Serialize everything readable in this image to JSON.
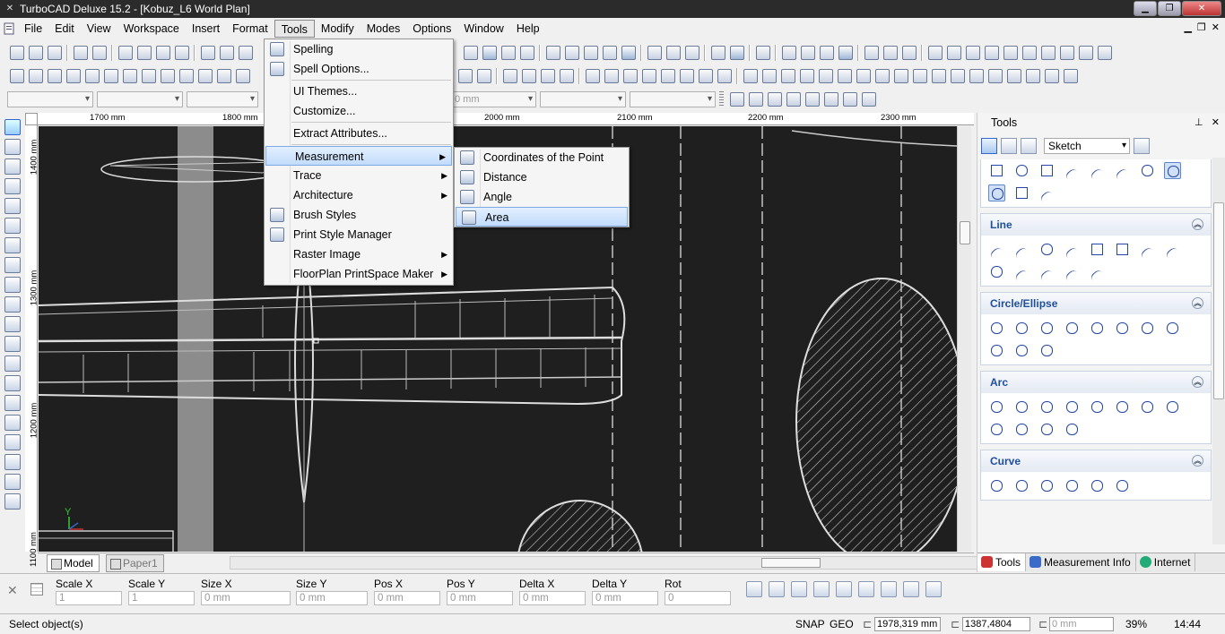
{
  "window": {
    "title": "TurboCAD Deluxe 15.2 - [Kobuz_L6 World Plan]"
  },
  "menubar": {
    "items": [
      "File",
      "Edit",
      "View",
      "Workspace",
      "Insert",
      "Format",
      "Tools",
      "Modify",
      "Modes",
      "Options",
      "Window",
      "Help"
    ],
    "active": "Tools"
  },
  "toolbar": {
    "combo_value": "0 mm"
  },
  "rulers": {
    "top": [
      "1700 mm",
      "1800 mm",
      "2000 mm",
      "2100 mm",
      "2200 mm",
      "2300 mm"
    ],
    "left": [
      "1400 mm",
      "1300 mm",
      "1200 mm",
      "1100 mm"
    ]
  },
  "tools_menu": {
    "items": [
      {
        "label": "Spelling",
        "icon": "spelling-icon"
      },
      {
        "label": "Spell Options...",
        "icon": "spell-options-icon"
      },
      {
        "label": "UI Themes..."
      },
      {
        "label": "Customize..."
      },
      {
        "label": "Extract Attributes..."
      },
      {
        "label": "Measurement",
        "submenu": true
      },
      {
        "label": "Trace",
        "submenu": true
      },
      {
        "label": "Architecture",
        "submenu": true
      },
      {
        "label": "Brush Styles",
        "icon": "brush-styles-icon"
      },
      {
        "label": "Print Style Manager",
        "icon": "print-style-icon"
      },
      {
        "label": "Raster Image",
        "submenu": true
      },
      {
        "label": "FloorPlan PrintSpace Maker",
        "submenu": true
      }
    ]
  },
  "measurement_submenu": {
    "items": [
      {
        "label": "Coordinates of the Point"
      },
      {
        "label": "Distance"
      },
      {
        "label": "Angle"
      },
      {
        "label": "Area"
      }
    ],
    "highlighted": "Area"
  },
  "tabs": {
    "model": "Model",
    "paper": "Paper1"
  },
  "inspector": {
    "fields": [
      {
        "label": "Scale X",
        "value": "1"
      },
      {
        "label": "Scale Y",
        "value": "1"
      },
      {
        "label": "Size X",
        "value": "0 mm"
      },
      {
        "label": "Size Y",
        "value": "0 mm"
      },
      {
        "label": "Pos X",
        "value": "0 mm"
      },
      {
        "label": "Pos Y",
        "value": "0 mm"
      },
      {
        "label": "Delta X",
        "value": "0 mm"
      },
      {
        "label": "Delta Y",
        "value": "0 mm"
      },
      {
        "label": "Rot",
        "value": "0"
      }
    ]
  },
  "status": {
    "message": "Select object(s)",
    "snap": "SNAP",
    "geo": "GEO",
    "x": "1978,319 mm",
    "y": "1387,4804 mm",
    "z": "0 mm",
    "zoom": "39%",
    "time": "14:44"
  },
  "tools_panel": {
    "title": "Tools",
    "mode": "Sketch",
    "groups": [
      "Line",
      "Circle/Ellipse",
      "Arc",
      "Curve"
    ],
    "tabs": [
      "Tools",
      "Measurement Info",
      "Internet"
    ]
  },
  "canvas": {
    "axis_y_label": "Y"
  }
}
